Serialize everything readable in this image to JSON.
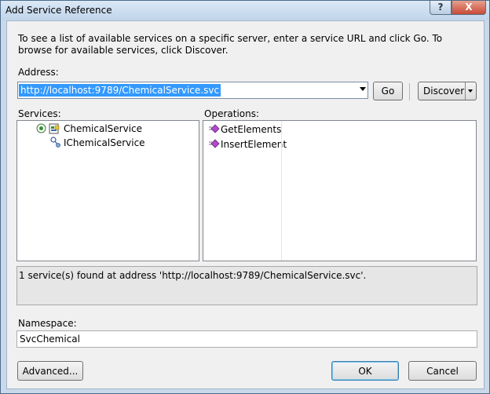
{
  "window": {
    "title": "Add Service Reference",
    "help_glyph": "?",
    "close_glyph": "X"
  },
  "intro_text": "To see a list of available services on a specific server, enter a service URL and click Go. To browse for available services, click Discover.",
  "address": {
    "label": "Address:",
    "value": "http://localhost:9789/ChemicalService.svc"
  },
  "buttons": {
    "go": "Go",
    "discover": "Discover",
    "advanced": "Advanced...",
    "ok": "OK",
    "cancel": "Cancel"
  },
  "services": {
    "label": "Services:",
    "items": [
      {
        "label": "ChemicalService",
        "icon": "service-icon"
      },
      {
        "label": "IChemicalService",
        "icon": "interface-icon"
      }
    ]
  },
  "operations": {
    "label": "Operations:",
    "items": [
      {
        "label": "GetElements",
        "icon": "method-icon"
      },
      {
        "label": "InsertElement",
        "icon": "method-icon"
      }
    ]
  },
  "status_text": "1 service(s) found at address 'http://localhost:9789/ChemicalService.svc'.",
  "namespace": {
    "label": "Namespace:",
    "value": "SvcChemical"
  },
  "colors": {
    "selection": "#3399ff",
    "close_button": "#c74b35",
    "method_icon": "#b04bc8"
  }
}
